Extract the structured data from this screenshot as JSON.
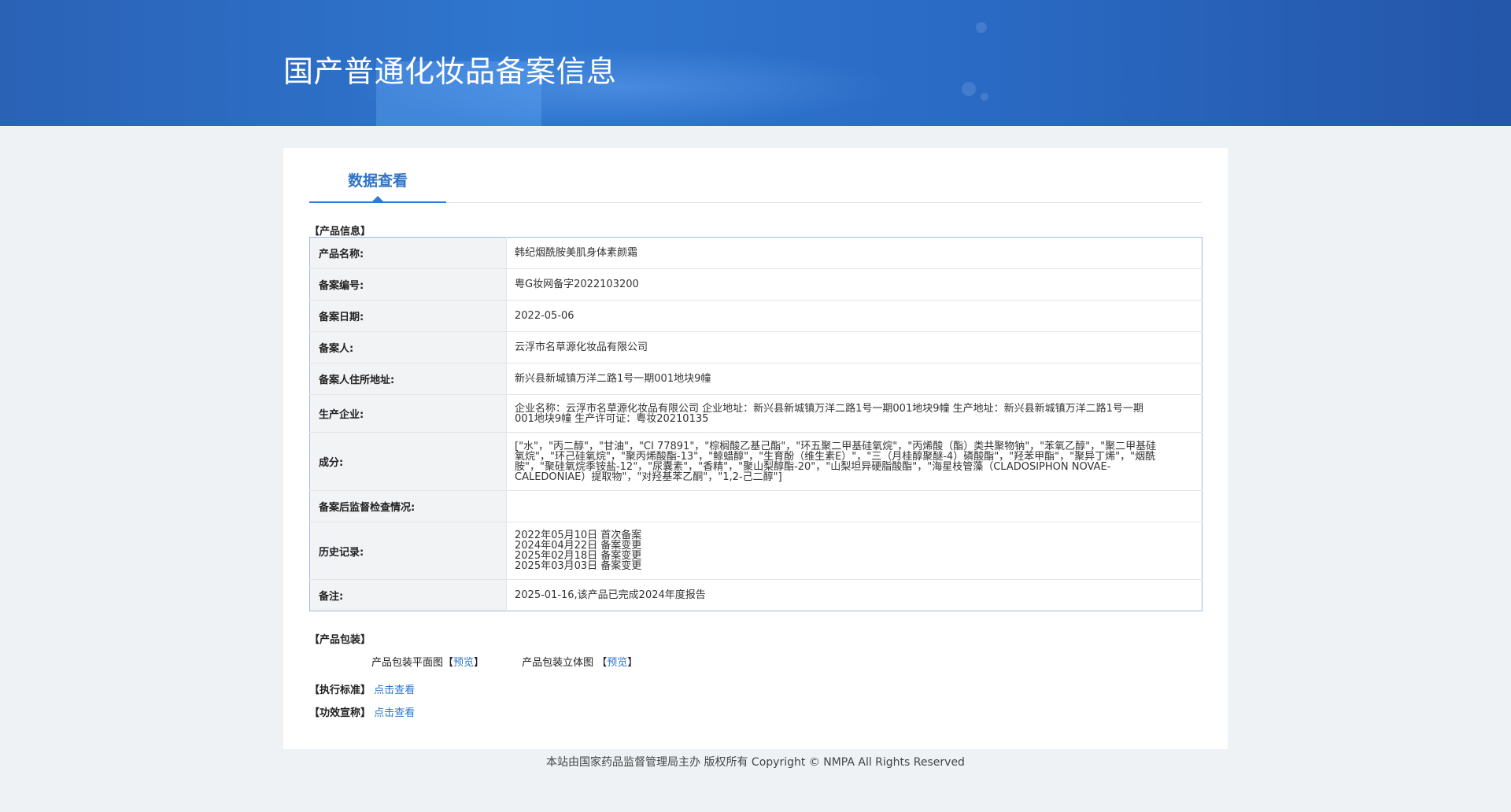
{
  "header": {
    "title": "国产普通化妆品备案信息"
  },
  "tabs": [
    {
      "label": "数据查看"
    }
  ],
  "product_info": {
    "section_title": "【产品信息】",
    "rows": [
      {
        "label": "产品名称:",
        "value": "韩纪烟酰胺美肌身体素颜霜"
      },
      {
        "label": "备案编号:",
        "value": "粤G妆网备字2022103200"
      },
      {
        "label": "备案日期:",
        "value": "2022-05-06"
      },
      {
        "label": "备案人:",
        "value": "云浮市名草源化妆品有限公司"
      },
      {
        "label": "备案人住所地址:",
        "value": "新兴县新城镇万洋二路1号一期001地块9幢"
      },
      {
        "label": "生产企业:",
        "value": "企业名称：云浮市名草源化妆品有限公司 企业地址：新兴县新城镇万洋二路1号一期001地块9幢 生产地址：新兴县新城镇万洋二路1号一期001地块9幢 生产许可证：粤妆20210135"
      },
      {
        "label": "成分:",
        "value": "[\"水\"，\"丙二醇\"，\"甘油\"，\"CI 77891\"，\"棕榈酸乙基己酯\"，\"环五聚二甲基硅氧烷\"，\"丙烯酸（酯）类共聚物钠\"，\"苯氧乙醇\"，\"聚二甲基硅氧烷\"，\"环己硅氧烷\"，\"聚丙烯酸酯-13\"，\"鲸蜡醇\"，\"生育酚（维生素E）\"，\"三（月桂醇聚醚-4）磷酸酯\"，\"羟苯甲酯\"，\"聚异丁烯\"，\"烟酰胺\"，\"聚硅氧烷季铵盐-12\"，\"尿囊素\"，\"香精\"，\"聚山梨醇酯-20\"，\"山梨坦异硬脂酸酯\"，\"海星枝管藻（CLADOSIPHON NOVAE-CALEDONIAE）提取物\"，\"对羟基苯乙酮\"，\"1,2-己二醇\"]"
      },
      {
        "label": "备案后监督检查情况:",
        "value": ""
      },
      {
        "label": "历史记录:",
        "value": ""
      },
      {
        "label": "备注:",
        "value": "2025-01-16,该产品已完成2024年度报告"
      }
    ],
    "history": [
      "2022年05月10日 首次备案",
      "2024年04月22日 备案变更",
      "2025年02月18日 备案变更",
      "2025年03月03日 备案变更"
    ]
  },
  "packaging": {
    "section_title": "【产品包装】",
    "flat_label": "产品包装平面图",
    "solid_label": "产品包装立体图",
    "bracket_open": "【",
    "bracket_close": "】",
    "preview_link": "预览"
  },
  "standard": {
    "label": "【执行标准】",
    "link": "点击查看"
  },
  "efficacy": {
    "label": "【功效宣称】",
    "link": "点击查看"
  },
  "footer": {
    "text": "本站由国家药品监督管理局主办 版权所有 Copyright © NMPA All Rights Reserved"
  }
}
